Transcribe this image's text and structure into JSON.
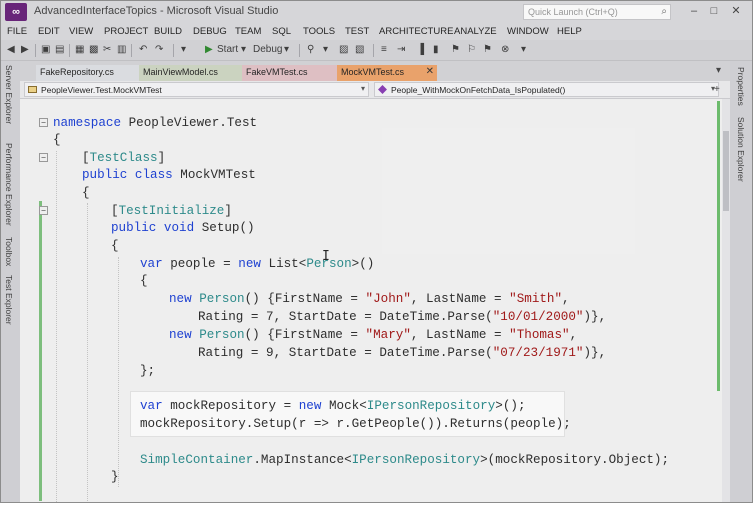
{
  "window": {
    "title": "AdvancedInterfaceTopics - Microsoft Visual Studio",
    "quick_launch_placeholder": "Quick Launch (Ctrl+Q)"
  },
  "menu": [
    "FILE",
    "EDIT",
    "VIEW",
    "PROJECT",
    "BUILD",
    "DEBUG",
    "TEAM",
    "SQL",
    "TOOLS",
    "TEST",
    "ARCHITECTURE",
    "ANALYZE",
    "WINDOW",
    "HELP"
  ],
  "toolbar": {
    "start_label": "Start",
    "config_label": "Debug"
  },
  "left_tool_windows": [
    "Server Explorer",
    "Performance Explorer",
    "Toolbox",
    "Test Explorer"
  ],
  "right_tool_windows": [
    "Properties",
    "Solution Explorer"
  ],
  "tabs": [
    {
      "label": "FakeRepository.cs"
    },
    {
      "label": "MainViewModel.cs"
    },
    {
      "label": "FakeVMTest.cs"
    },
    {
      "label": "MockVMTest.cs",
      "active": true
    }
  ],
  "navbar": {
    "class_combo": "PeopleViewer.Test.MockVMTest",
    "member_combo": "People_WithMockOnFetchData_IsPopulated()"
  },
  "code": {
    "l1": [
      "namespace",
      " PeopleViewer.Test"
    ],
    "l2": "{",
    "l3": [
      "[",
      "TestClass",
      "]"
    ],
    "l4": [
      "public class",
      " MockVMTest"
    ],
    "l5": "{",
    "l6": [
      "[",
      "TestInitialize",
      "]"
    ],
    "l7": [
      "public void",
      " Setup()"
    ],
    "l8": "{",
    "l9": [
      "var",
      " people = ",
      "new",
      " List<",
      "Person",
      ">()"
    ],
    "l10": "{",
    "l11": [
      "new",
      " ",
      "Person",
      "() {FirstName = ",
      "\"John\"",
      ", LastName = ",
      "\"Smith\"",
      ","
    ],
    "l12": [
      "Rating = 7, StartDate = DateTime.Parse(",
      "\"10/01/2000\"",
      ")},"
    ],
    "l13": [
      "new",
      " ",
      "Person",
      "() {FirstName = ",
      "\"Mary\"",
      ", LastName = ",
      "\"Thomas\"",
      ","
    ],
    "l14": [
      "Rating = 9, StartDate = DateTime.Parse(",
      "\"07/23/1971\"",
      ")},"
    ],
    "l15": "};",
    "l16": [
      "var",
      " mockRepository = ",
      "new",
      " Mock<",
      "IPersonRepository",
      ">();"
    ],
    "l17": "mockRepository.Setup(r => r.GetPeople()).Returns(people);",
    "l18": [
      "SimpleContainer",
      ".MapInstance<",
      "IPersonRepository",
      ">(mockRepository.Object);"
    ],
    "l19": "}"
  },
  "colors": {
    "keyword": "#1a3fd6",
    "type": "#2a8c8c",
    "string": "#a31515",
    "active_tab": "#f0a56b",
    "change_marker": "#6cbf6c"
  }
}
